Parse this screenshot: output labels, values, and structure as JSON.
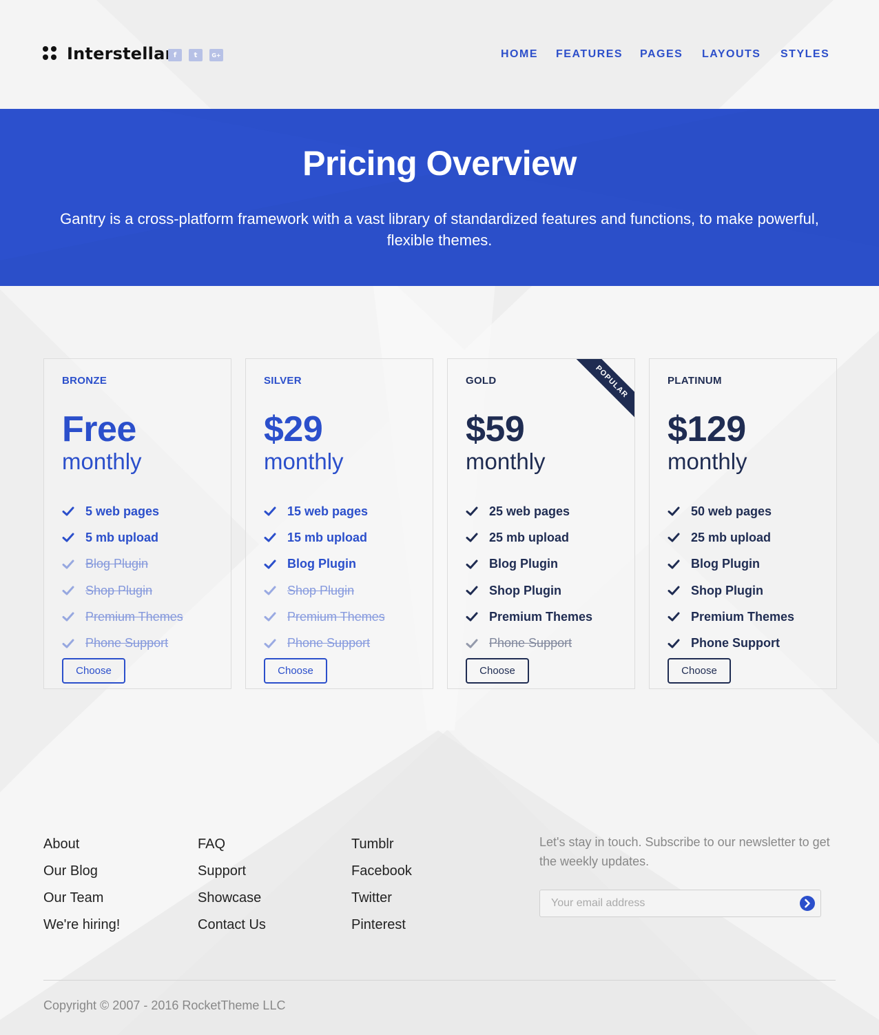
{
  "brand": {
    "name": "Interstellar"
  },
  "social": [
    {
      "icon": "facebook-icon",
      "glyph": "f"
    },
    {
      "icon": "twitter-icon",
      "glyph": "t"
    },
    {
      "icon": "google-plus-icon",
      "glyph": "G+"
    }
  ],
  "nav": {
    "home": "HOME",
    "features": "FEATURES",
    "pages": "PAGES",
    "layouts": "LAYOUTS",
    "styles": "STYLES"
  },
  "hero": {
    "title": "Pricing Overview",
    "subtitle": "Gantry is a cross-platform framework with a vast library of standardized features and functions, to make powerful, flexible themes."
  },
  "plans": [
    {
      "tier": "BRONZE",
      "price": "Free",
      "period": "monthly",
      "choose": "Choose",
      "features": [
        {
          "label": "5 web pages",
          "on": true
        },
        {
          "label": "5 mb upload",
          "on": true
        },
        {
          "label": "Blog Plugin",
          "on": false
        },
        {
          "label": "Shop Plugin",
          "on": false
        },
        {
          "label": "Premium Themes",
          "on": false
        },
        {
          "label": "Phone Support",
          "on": false
        }
      ]
    },
    {
      "tier": "SILVER",
      "price": "$29",
      "period": "monthly",
      "choose": "Choose",
      "features": [
        {
          "label": "15 web pages",
          "on": true
        },
        {
          "label": "15 mb upload",
          "on": true
        },
        {
          "label": "Blog Plugin",
          "on": true
        },
        {
          "label": "Shop Plugin",
          "on": false
        },
        {
          "label": "Premium Themes",
          "on": false
        },
        {
          "label": "Phone Support",
          "on": false
        }
      ]
    },
    {
      "tier": "GOLD",
      "price": "$59",
      "period": "monthly",
      "choose": "Choose",
      "ribbon": "POPULAR",
      "features": [
        {
          "label": "25 web pages",
          "on": true
        },
        {
          "label": "25 mb upload",
          "on": true
        },
        {
          "label": "Blog Plugin",
          "on": true
        },
        {
          "label": "Shop Plugin",
          "on": true
        },
        {
          "label": "Premium Themes",
          "on": true
        },
        {
          "label": "Phone Support",
          "on": false
        }
      ]
    },
    {
      "tier": "PLATINUM",
      "price": "$129",
      "period": "monthly",
      "choose": "Choose",
      "features": [
        {
          "label": "50 web pages",
          "on": true
        },
        {
          "label": "25 mb upload",
          "on": true
        },
        {
          "label": "Blog Plugin",
          "on": true
        },
        {
          "label": "Shop Plugin",
          "on": true
        },
        {
          "label": "Premium Themes",
          "on": true
        },
        {
          "label": "Phone Support",
          "on": true
        }
      ]
    }
  ],
  "footer": {
    "col1": [
      "About",
      "Our Blog",
      "Our Team",
      "We're hiring!"
    ],
    "col2": [
      "FAQ",
      "Support",
      "Showcase",
      "Contact Us"
    ],
    "col3": [
      "Tumblr",
      "Facebook",
      "Twitter",
      "Pinterest"
    ],
    "newsletter_text": "Let's stay in touch. Subscribe to our newsletter to get the weekly updates.",
    "email_placeholder": "Your email address",
    "copyright": "Copyright © 2007 - 2016 RocketTheme LLC"
  },
  "colors": {
    "accent": "#2b4fcb",
    "dark": "#1f2c52",
    "background": "#eeeeee"
  }
}
